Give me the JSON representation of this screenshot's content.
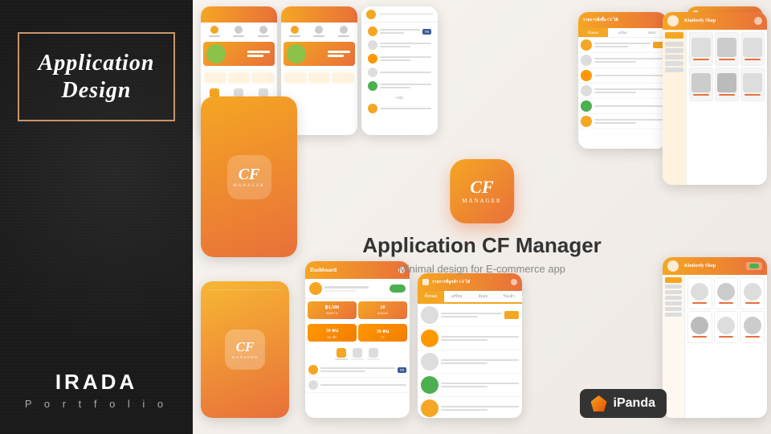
{
  "left": {
    "title_line1": "Application",
    "title_line2": "Design",
    "portfolio_name": "IRADA",
    "portfolio_label": "P o r t f o l i o"
  },
  "center": {
    "app_icon_cf": "CF",
    "app_icon_manager": "MANAGER",
    "app_title": "Application CF Manager",
    "app_subtitle": "Minimal design for E-commerce app"
  },
  "badge": {
    "label": "iPanda"
  },
  "phones": {
    "dashboard_title": "Dashboard",
    "report_title": "รายการที่ลูกค้า CF ได้",
    "stats": [
      {
        "value": "฿1,500",
        "label": "ยอดขาย"
      },
      {
        "value": "20",
        "label": "ออเดอร์"
      },
      {
        "value": "30 คน",
        "label": "สมาชิก"
      },
      {
        "value": "30 คน",
        "label": "สมาชิก"
      }
    ]
  }
}
